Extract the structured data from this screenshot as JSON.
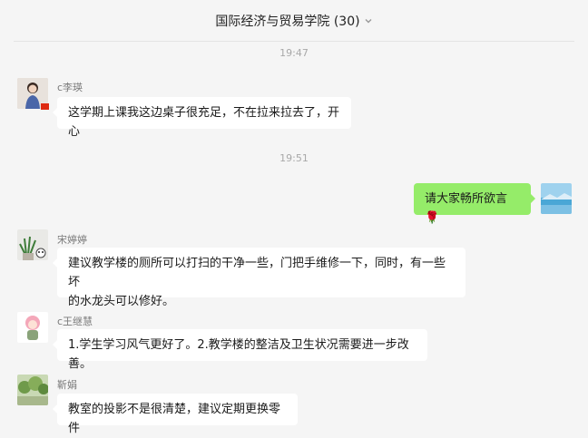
{
  "header": {
    "title": "国际经济与贸易学院 (30)"
  },
  "timestamps": [
    "19:47",
    "19:51"
  ],
  "messages": [
    {
      "sender": "c李瑛",
      "text": "这学期上课我这边桌子很充足，不在拉来拉去了，开心"
    },
    {
      "sender": "",
      "text": "请大家畅所欲言",
      "emoji": "🌹"
    },
    {
      "sender": "宋婷婷",
      "lines": [
        "建议教学楼的厕所可以打扫的干净一些，门把手维修一下，同时，有一些坏",
        "的水龙头可以修好。"
      ]
    },
    {
      "sender": "c王继慧",
      "text": "1.学生学习风气更好了。2.教学楼的整洁及卫生状况需要进一步改善。"
    },
    {
      "sender": "靳娟",
      "text": "教室的投影不是很清楚，建议定期更换零件"
    }
  ]
}
